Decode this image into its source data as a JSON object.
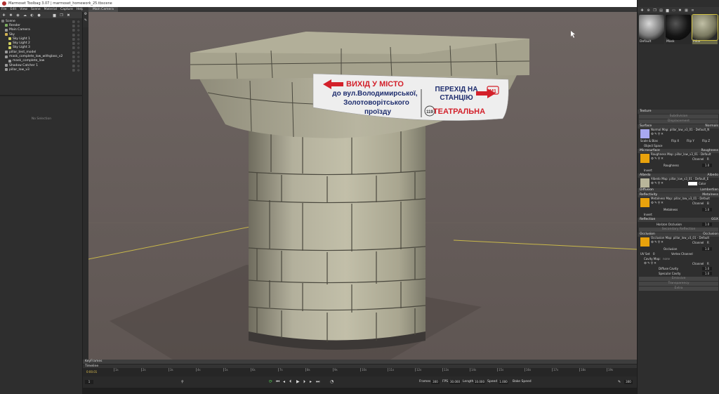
{
  "window": {
    "title": "Marmoset Toolbag 3.07  |  marmoset_homework_25.tbscene",
    "minimize": "–",
    "maximize": "▢",
    "close": "✕"
  },
  "menu": [
    "File",
    "Edit",
    "View",
    "Scene",
    "Material",
    "Capture",
    "Help"
  ],
  "scene_tree": [
    {
      "label": "Scene",
      "color": "#7a7a7a",
      "indent": 0
    },
    {
      "label": "Render",
      "color": "#7fb060",
      "indent": 1
    },
    {
      "label": "Main Camera",
      "color": "#9a9a9a",
      "indent": 1
    },
    {
      "label": "Sky",
      "color": "#d0b050",
      "indent": 1
    },
    {
      "label": "Sky Light 1",
      "color": "#d0d060",
      "indent": 2
    },
    {
      "label": "Sky Light 2",
      "color": "#d0d060",
      "indent": 2
    },
    {
      "label": "Sky Light 3",
      "color": "#d0d060",
      "indent": 2
    },
    {
      "label": "pillar_test_model",
      "color": "#9a9a9a",
      "indent": 1
    },
    {
      "label": "mask_complete_low_withglass_v2",
      "color": "#9a9a9a",
      "indent": 1
    },
    {
      "label": "mask_complete_low",
      "color": "#9a9a9a",
      "indent": 2
    },
    {
      "label": "Shadow Catcher 1",
      "color": "#9a9a9a",
      "indent": 1
    },
    {
      "label": "pillar_low_v3",
      "color": "#9a9a9a",
      "indent": 1
    }
  ],
  "no_selection": "No Selection",
  "viewport_tab": "Main Camera",
  "sign": {
    "left_line1": "ВИХІД У МІСТО",
    "left_line2": "до вул.Володимирської,",
    "left_line3": "Золотоворітського",
    "left_line4": "проїзду",
    "right_line1": "ПЕРЕХІД НА",
    "right_line2": "СТАНЦІЮ",
    "metro_badge": "M1",
    "station_number": "119",
    "station_name": "ТЕАТРАЛЬНА"
  },
  "timeline": {
    "keyframes_label": "KeyFrames",
    "timeline_label": "Timeline",
    "current_time": "0:00.01",
    "ticks": [
      "1s",
      "2s",
      "3s",
      "4s",
      "5s",
      "6s",
      "7s",
      "8s",
      "9s",
      "10s",
      "11s",
      "12s",
      "13s",
      "14s",
      "15s",
      "16s",
      "17s",
      "18s",
      "19s"
    ],
    "frame_field": "1",
    "frames_label": "Frames",
    "frames_value": "300",
    "fps_label": "FPS",
    "fps_value": "30.000",
    "length_label": "Length",
    "length_value": "10.000",
    "speed_label": "Speed",
    "speed_value": "1.000",
    "bake_speed": "Bake Speed",
    "end_value": "300"
  },
  "materials": [
    {
      "label": "Default",
      "color": "#9c9c9c"
    },
    {
      "label": "Mask",
      "color": "#1c1c1c"
    },
    {
      "label": "Pillar",
      "color": "#8b8a70"
    }
  ],
  "sections": {
    "texture": "Texture",
    "subdivision": "Subdivision",
    "displacement": "Displacement",
    "surface": "Surface",
    "surface_val": "Normals",
    "normal_map": "Normal Map: pillar_low_v3_01 - Default_N",
    "scale_bias": "Scale & Bias",
    "flip_x": "Flip X",
    "flip_y": "Flip Y",
    "flip_z": "Flip Z",
    "object_space": "Object Space",
    "microsurface": "Microsurface",
    "microsurface_val": "Roughness",
    "roughness_map": "Roughness Map: pillar_low_v3_01 - Default",
    "channel": "Channel",
    "channel_r": "R",
    "channel_b": "B",
    "roughness": "Roughness",
    "val_one": "1.0",
    "invert": "Invert",
    "albedo": "Albedo",
    "albedo_val": "Albedo",
    "albedo_map": "Albedo Map: pillar_low_v3_01 - Default_E",
    "color": "Color",
    "diffusion": "Diffusion",
    "diffusion_val": "Lambertian",
    "reflectivity": "Reflectivity",
    "reflectivity_val": "Metalness",
    "metalness_map": "Metalness Map: pillar_low_v3_01 - Default",
    "metalness": "Metalness",
    "reflection": "Reflection",
    "reflection_val": "GGX",
    "horizon_occlusion": "Horizon Occlusion",
    "secondary_reflection": "Secondary Reflection",
    "occlusion": "Occlusion",
    "occlusion_val": "Occlusion",
    "occlusion_map": "Occlusion Map: pillar_low_v3_01 - Default",
    "occlusion_label": "Occlusion",
    "uv_set": "UV Set",
    "uv_set_val": "0",
    "vertex_channel": "Vertex Channel",
    "cavity_map": "Cavity Map:",
    "cavity_none": "none",
    "diffuse_cavity": "Diffuse Cavity",
    "specular_cavity": "Specular Cavity",
    "emissive": "Emissive",
    "transparency": "Transparency",
    "extra": "Extra"
  }
}
